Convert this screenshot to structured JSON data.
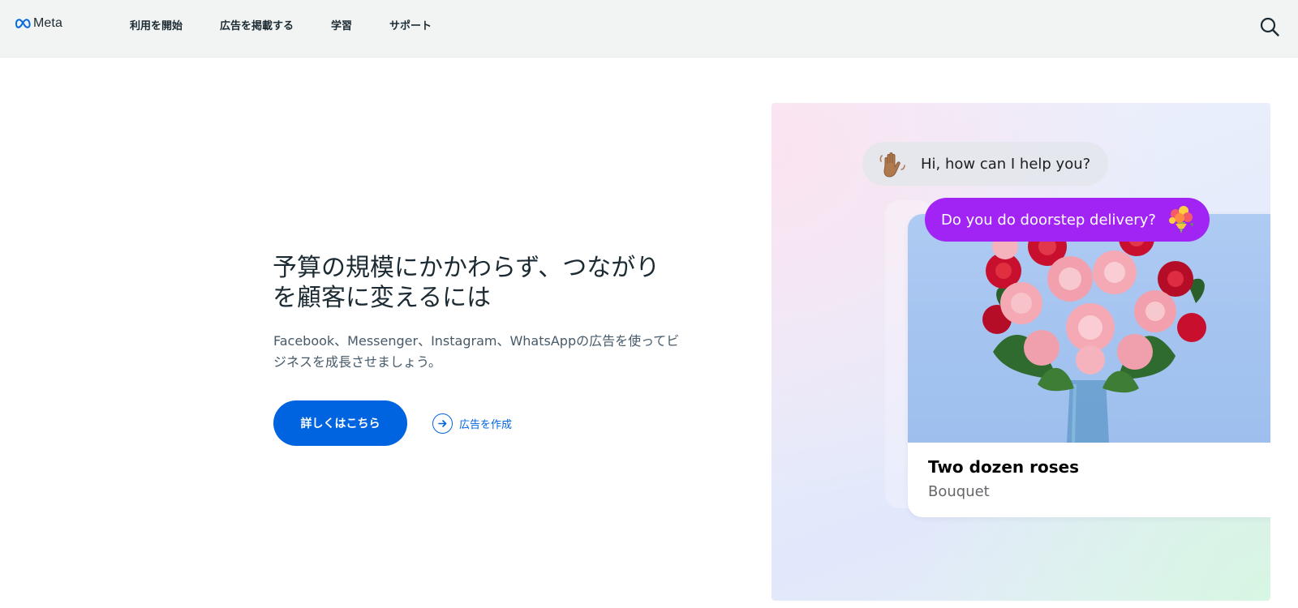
{
  "header": {
    "logo_text": "Meta",
    "nav": [
      {
        "label": "利用を開始"
      },
      {
        "label": "広告を掲載する"
      },
      {
        "label": "学習"
      },
      {
        "label": "サポート"
      }
    ],
    "search_icon": "search-icon"
  },
  "hero": {
    "title": "予算の規模にかかわらず、つながりを顧客に変えるには",
    "subtitle": "Facebook、Messenger、Instagram、WhatsAppの広告を使ってビジネスを成長させましょう。",
    "primary_button": "詳しくはこちら",
    "secondary_link": "広告を作成",
    "secondary_icon": "arrow-right-circle-icon"
  },
  "visual": {
    "incoming_message": "Hi, how can I help you?",
    "incoming_emoji": "waving-hand-icon",
    "outgoing_message": "Do you do doorstep delivery?",
    "outgoing_emoji": "bouquet-icon",
    "product_name": "Two dozen roses",
    "product_type": "Bouquet"
  },
  "colors": {
    "accent": "#0064e0",
    "message_purple": "#a224f5",
    "header_bg": "#f1f4f2",
    "text_dark": "#1c2b33",
    "text_muted": "#465a69"
  }
}
